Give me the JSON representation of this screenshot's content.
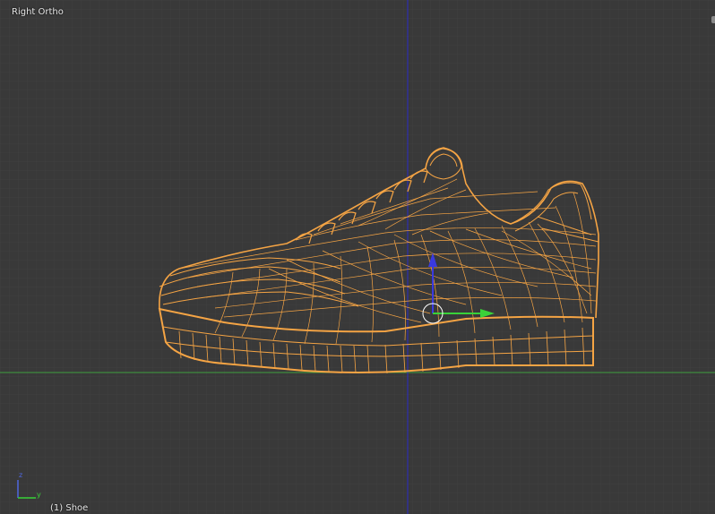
{
  "viewport": {
    "view_name": "Right Ortho",
    "active_object": "(1) Shoe",
    "axis_gizmo": {
      "z_label": "z",
      "y_label": "y"
    },
    "colors": {
      "background": "#393939",
      "grid": "#444444",
      "wire_selected": "#f5a444",
      "axis_y": "#3f9e3f",
      "axis_z": "#2b2bc7",
      "manip_z": "#3a3ae0",
      "manip_y": "#39d239"
    }
  }
}
